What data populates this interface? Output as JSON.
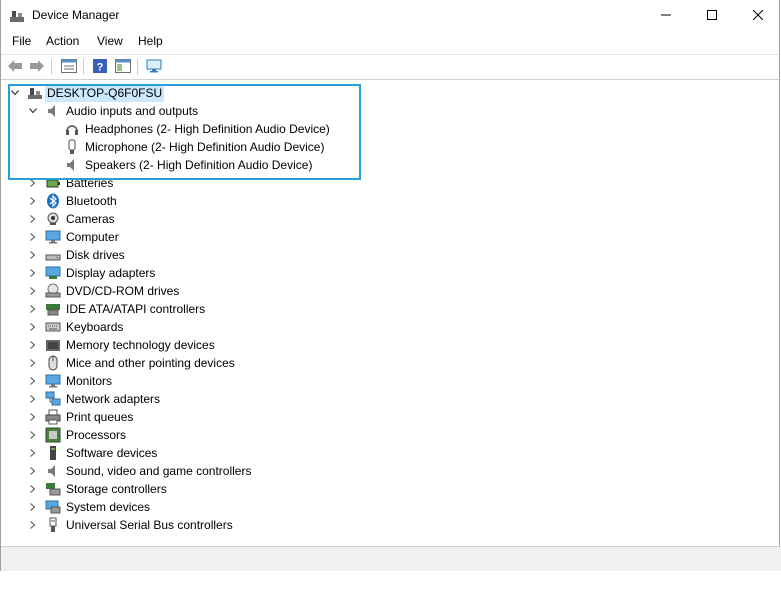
{
  "window": {
    "title": "Device Manager",
    "controls": {
      "minimize": "minimize-icon",
      "maximize": "maximize-icon",
      "close": "close-icon"
    }
  },
  "menu": [
    "File",
    "Action",
    "View",
    "Help"
  ],
  "toolbar": {
    "buttons": [
      "back-arrow-icon",
      "forward-arrow-icon",
      "properties-list-icon",
      "help-icon",
      "show-hide-icon",
      "scan-hardware-icon"
    ]
  },
  "tree": {
    "root": {
      "label": "DESKTOP-Q6F0FSU",
      "expanded": true,
      "selected": true
    },
    "audio": {
      "label": "Audio inputs and outputs",
      "expanded": true,
      "children": [
        "Headphones (2- High Definition Audio Device)",
        "Microphone (2- High Definition Audio Device)",
        "Speakers (2- High Definition Audio Device)"
      ]
    },
    "categories": [
      "Batteries",
      "Bluetooth",
      "Cameras",
      "Computer",
      "Disk drives",
      "Display adapters",
      "DVD/CD-ROM drives",
      "IDE ATA/ATAPI controllers",
      "Keyboards",
      "Memory technology devices",
      "Mice and other pointing devices",
      "Monitors",
      "Network adapters",
      "Print queues",
      "Processors",
      "Software devices",
      "Sound, video and game controllers",
      "Storage controllers",
      "System devices",
      "Universal Serial Bus controllers"
    ]
  },
  "colors": {
    "selection": "#cce8ff",
    "highlight_border": "#2a9fd6"
  }
}
